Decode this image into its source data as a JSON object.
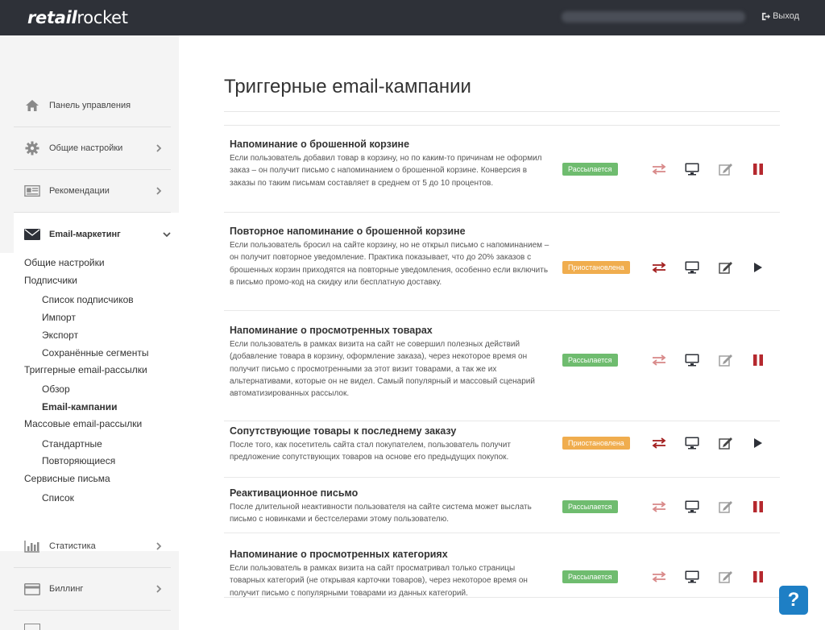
{
  "header": {
    "logo_bold": "retail",
    "logo_rest": "rocket",
    "logout_label": "Выход"
  },
  "sidebar": {
    "items": [
      {
        "label": "Панель управления",
        "icon": "home-icon"
      },
      {
        "label": "Общие настройки",
        "icon": "gear-icon"
      },
      {
        "label": "Рекомендации",
        "icon": "recommendations-icon"
      },
      {
        "label": "Email-маркетинг",
        "icon": "envelope-icon"
      },
      {
        "label": "Статистика",
        "icon": "bar-chart-icon"
      },
      {
        "label": "Биллинг",
        "icon": "credit-card-icon"
      }
    ],
    "sub": {
      "general": "Общие настройки",
      "subscribers": "Подписчики",
      "subscribers_list": "Список подписчиков",
      "import": "Импорт",
      "export": "Экспорт",
      "saved_segments": "Сохранённые сегменты",
      "trigger_mailings": "Триггерные email-рассылки",
      "overview": "Обзор",
      "email_campaigns": "Email-кампании",
      "mass_mailings": "Массовые email-рассылки",
      "standard": "Стандартные",
      "recurring": "Повторяющиеся",
      "service_letters": "Сервисные письма",
      "list": "Список"
    }
  },
  "main": {
    "title": "Триггерные email-кампании",
    "campaigns": [
      {
        "name": "Напоминание о брошенной корзине",
        "desc": "Если пользователь добавил товар в корзину, но по каким-то причинам не оформил заказ – он получит письмо с напоминанием о брошенной корзине. Конверсия в заказы по таким письмам составляет в среднем от 5 до 10 процентов.",
        "status": "Рассылается"
      },
      {
        "name": "Повторное напоминание о брошенной корзине",
        "desc": "Если пользователь бросил на сайте корзину, но не открыл письмо с напоминанием – он получит повторное уведомление. Практика показывает, что до 20% заказов с брошенных корзин приходятся на повторные уведомления, особенно если включить в письмо промо-код на скидку или бесплатную доставку.",
        "status": "Приостановлена"
      },
      {
        "name": "Напоминание о просмотренных товарах",
        "desc": "Если пользователь в рамках визита на сайт не совершил полезных действий (добавление товара в корзину, оформление заказа), через некоторое время он получит письмо с просмотренными за этот визит товарами, а так же их альтернативами, которые он не видел. Самый популярный и массовый сценарий автоматизированных рассылок.",
        "status": "Рассылается"
      },
      {
        "name": "Сопутствующие товары к последнему заказу",
        "desc": "После того, как посетитель сайта стал покупателем, пользователь получит предложение сопутствующих товаров на основе его предыдущих покупок.",
        "status": "Приостановлена"
      },
      {
        "name": "Реактивационное письмо",
        "desc": "После длительной неактивности пользователя на сайте система может выслать письмо с новинками и бестселерами этому пользователю.",
        "status": "Рассылается"
      },
      {
        "name": "Напоминание о просмотренных категориях",
        "desc": "Если пользователь в рамках визита на сайт просматривал только страницы товарных категорий (не открывая карточки товаров), через некоторое время он получит письмо с популярными товарами из данных категорий.",
        "status": "Рассылается"
      }
    ]
  },
  "help_label": "?",
  "colors": {
    "topbar": "#2e3138",
    "badge_active": "#6fbc6f",
    "badge_paused": "#f0ad4e",
    "pause_red": "#b5282e",
    "help_blue": "#1e7fc5"
  }
}
